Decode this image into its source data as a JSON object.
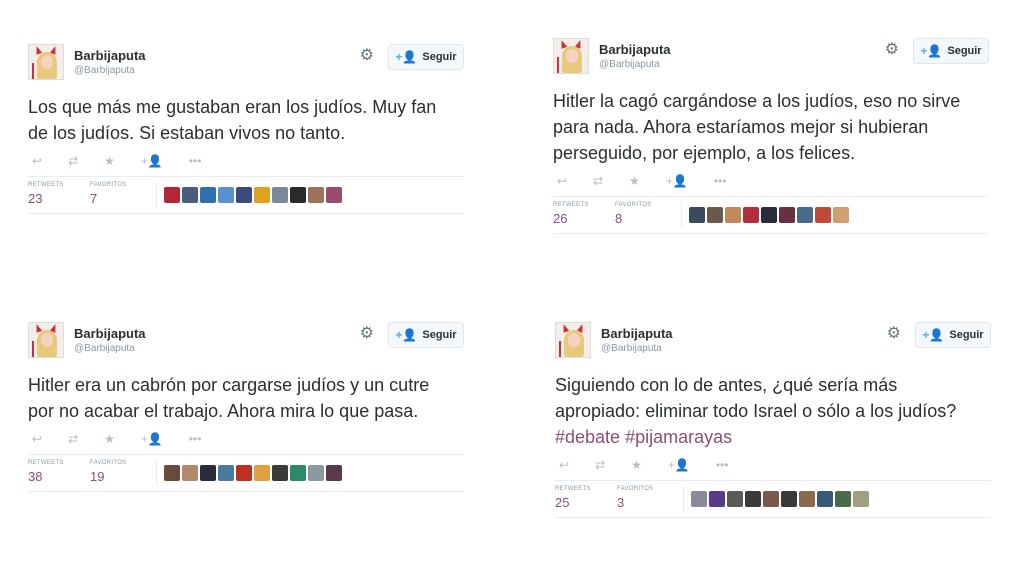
{
  "tweets": [
    {
      "name": "Barbijaputa",
      "handle": "@Barbijaputa",
      "follow_label": "Seguir",
      "text": "Los que más me gustaban eran los judíos. Muy fan de los judíos. Si estaban vivos no tanto.",
      "hashtags": [],
      "retweets_label": "RETWEETS",
      "retweets": "23",
      "favorites_label": "FAVORITOS",
      "favorites": "7",
      "favoriter_avatars": [
        "#b3263a",
        "#4a5d7a",
        "#2f6fb0",
        "#5a8fd0",
        "#3b4a7a",
        "#e0a020",
        "#7a8a9a",
        "#2a2a2a",
        "#a07058",
        "#9a4a6a"
      ]
    },
    {
      "name": "Barbijaputa",
      "handle": "@Barbijaputa",
      "follow_label": "Seguir",
      "text": "Hitler la cagó cargándose a los judíos, eso no sirve para nada. Ahora estaríamos mejor si hubieran perseguido, por ejemplo, a los felices.",
      "hashtags": [],
      "retweets_label": "RETWEETS",
      "retweets": "26",
      "favorites_label": "FAVORITOS",
      "favorites": "8",
      "favoriter_avatars": [
        "#3a4a5a",
        "#6a5a4a",
        "#c08a5a",
        "#b03040",
        "#2a2a3a",
        "#6a3040",
        "#4a6a8a",
        "#c04a3a",
        "#d0a070"
      ]
    },
    {
      "name": "Barbijaputa",
      "handle": "@Barbijaputa",
      "follow_label": "Seguir",
      "text": "Hitler era un cabrón por cargarse judíos y un cutre por no acabar el trabajo. Ahora mira lo que pasa.",
      "hashtags": [],
      "retweets_label": "RETWEETS",
      "retweets": "38",
      "favorites_label": "FAVORITOS",
      "favorites": "19",
      "favoriter_avatars": [
        "#6a4a3a",
        "#b08a6a",
        "#2a2a3a",
        "#4a7aa0",
        "#c03020",
        "#e0a040",
        "#3a3a3a",
        "#2a8a6a",
        "#8a9aa0",
        "#5a3a4a"
      ]
    },
    {
      "name": "Barbijaputa",
      "handle": "@Barbijaputa",
      "follow_label": "Seguir",
      "text": "Siguiendo con lo de antes, ¿qué sería más apropiado: eliminar todo Israel o sólo a los judíos?",
      "hashtags": [
        "#debate",
        "#pijamarayas"
      ],
      "retweets_label": "RETWEETS",
      "retweets": "25",
      "favorites_label": "FAVORITOS",
      "favorites": "3",
      "favoriter_avatars": [
        "#8a8a9a",
        "#5a3a8a",
        "#5a5a5a",
        "#3a3a3a",
        "#7a5a4a",
        "#3a3a3a",
        "#8a6a4a",
        "#3a5a7a",
        "#4a6a4a",
        "#a0a080"
      ]
    }
  ],
  "icons": {
    "gear": "gear-icon",
    "follow": "add-user-icon",
    "reply": "reply-icon",
    "retweet": "retweet-icon",
    "favorite": "star-icon",
    "follow_small": "follow-icon",
    "more": "more-icon"
  }
}
